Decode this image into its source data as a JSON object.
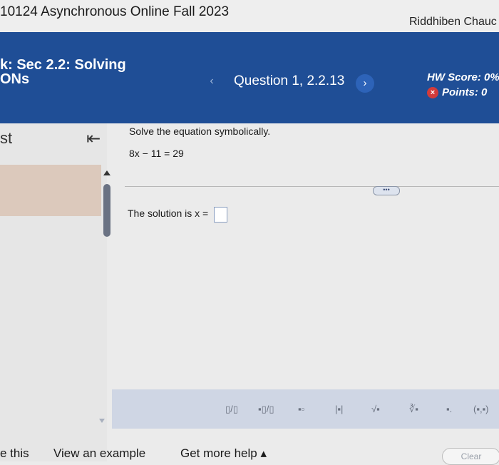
{
  "topbar": {
    "course_title": "10124 Asynchronous Online Fall 2023",
    "user_name": "Riddhiben Chauc"
  },
  "header": {
    "hw_title": "k: Sec 2.2: Solving\nONs",
    "prev_icon": "‹",
    "question_label": "Question 1, 2.2.13",
    "next_icon": "›",
    "hw_score": "HW Score: 0%",
    "points_icon": "×",
    "points": "Points: 0"
  },
  "sidebar": {
    "label": "st",
    "collapse_icon": "⇤"
  },
  "question": {
    "prompt": "Solve the equation symbolically.",
    "equation": "8x − 11 = 29",
    "more_label": "•••",
    "answer_prefix": "The solution is x ="
  },
  "palette": {
    "buttons": [
      {
        "name": "fraction-button",
        "label": "▯/▯"
      },
      {
        "name": "mixed-number-button",
        "label": "▪▯/▯"
      },
      {
        "name": "exponent-button",
        "label": "▪▫"
      },
      {
        "name": "absolute-value-button",
        "label": "|▪|"
      },
      {
        "name": "square-root-button",
        "label": "√▪"
      },
      {
        "name": "nth-root-button",
        "label": "∛▪"
      },
      {
        "name": "subscript-button",
        "label": "▪."
      },
      {
        "name": "ordered-pair-button",
        "label": "(▪,▪)"
      }
    ]
  },
  "footer": {
    "help_solve": "e this",
    "view_example": "View an example",
    "get_more_help": "Get more help ▴",
    "close_label": "Clear"
  }
}
